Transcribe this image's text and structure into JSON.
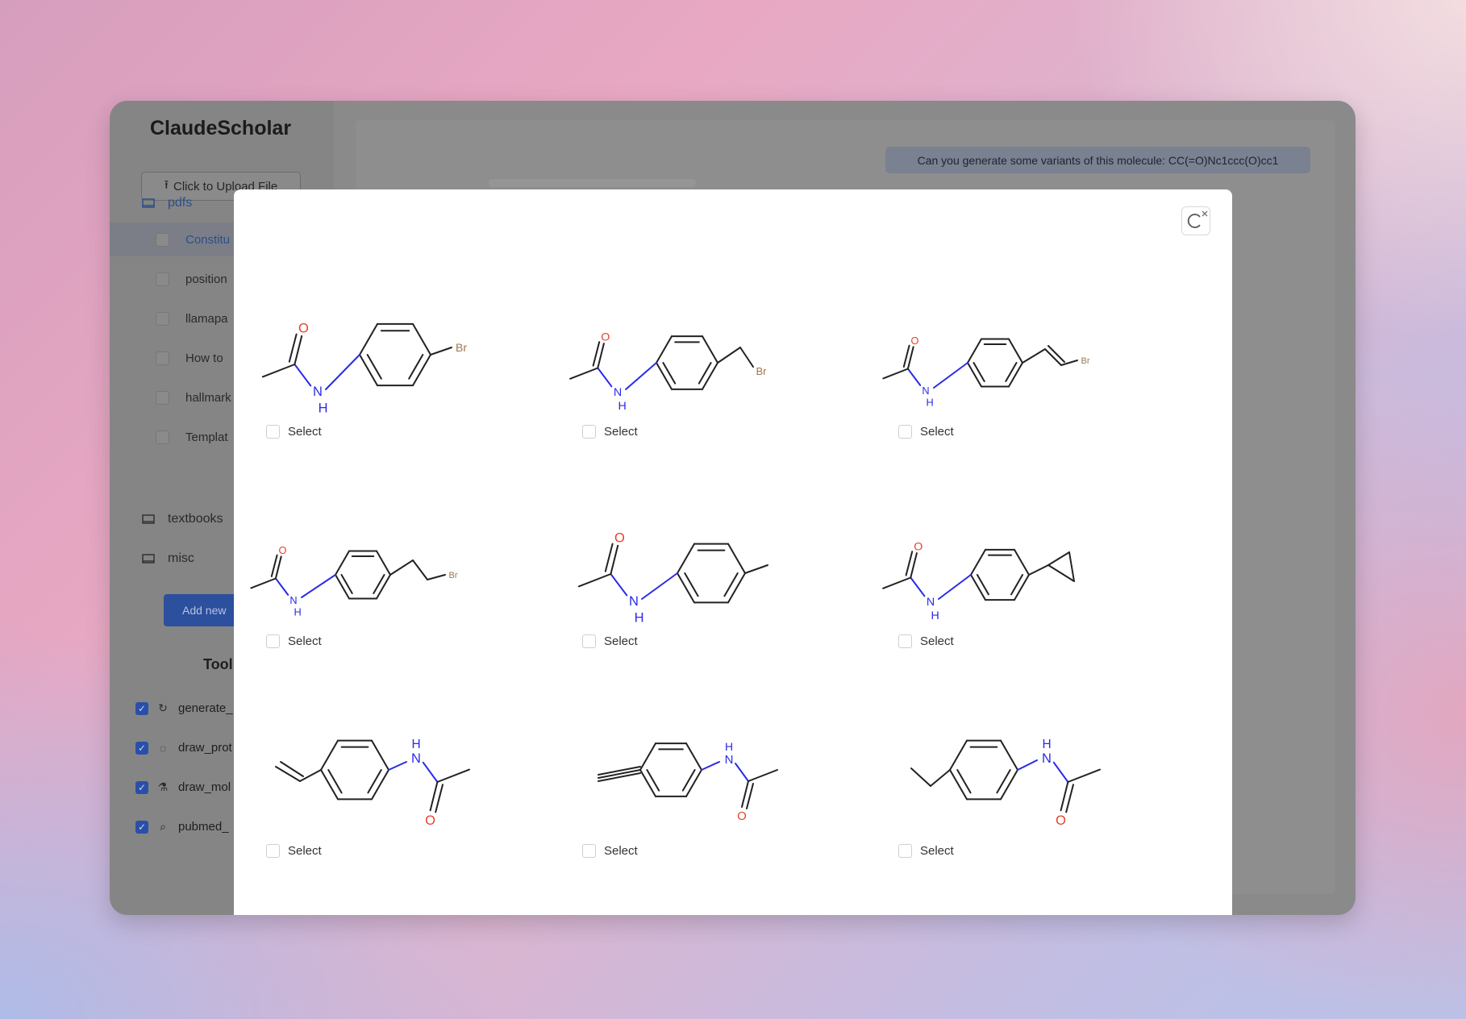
{
  "app": {
    "title": "ClaudeScholar"
  },
  "sidebar": {
    "upload_label": "Click to Upload File",
    "folders": [
      {
        "name": "pdfs",
        "open": true,
        "files": [
          "Constitu",
          "position",
          "llamapa",
          "How to",
          "hallmark",
          "Templat"
        ]
      },
      {
        "name": "textbooks"
      },
      {
        "name": "misc"
      }
    ],
    "add_button": "Add new",
    "tools_heading": "Tool",
    "tools": [
      {
        "name": "generate_",
        "icon": "refresh-icon",
        "checked": true
      },
      {
        "name": "draw_prot",
        "icon": "drop-icon",
        "checked": true
      },
      {
        "name": "draw_mol",
        "icon": "flask-icon",
        "checked": true
      },
      {
        "name": "pubmed_",
        "icon": "search-icon",
        "checked": true
      }
    ]
  },
  "chat": {
    "user_message": "Can you generate some variants of this molecule: CC(=O)Nc1ccc(O)cc1"
  },
  "modal": {
    "select_label": "Select",
    "molecules": [
      {
        "tail": "Br",
        "checked": false
      },
      {
        "tail": "Br",
        "checked": false
      },
      {
        "tail": "Br",
        "checked": false
      },
      {
        "tail": "Br",
        "checked": false
      },
      {
        "tail": "",
        "checked": false
      },
      {
        "tail": "",
        "checked": false
      },
      {
        "tail": "",
        "checked": false
      },
      {
        "tail": "",
        "checked": false
      },
      {
        "tail": "",
        "checked": false
      }
    ],
    "atom_labels": {
      "oxygen": "O",
      "nitrogen": "N",
      "hydrogen": "H"
    },
    "colors": {
      "oxygen": "#e8412a",
      "nitrogen": "#2a2ae8",
      "bromine": "#a0764a",
      "bond": "#222222"
    }
  }
}
